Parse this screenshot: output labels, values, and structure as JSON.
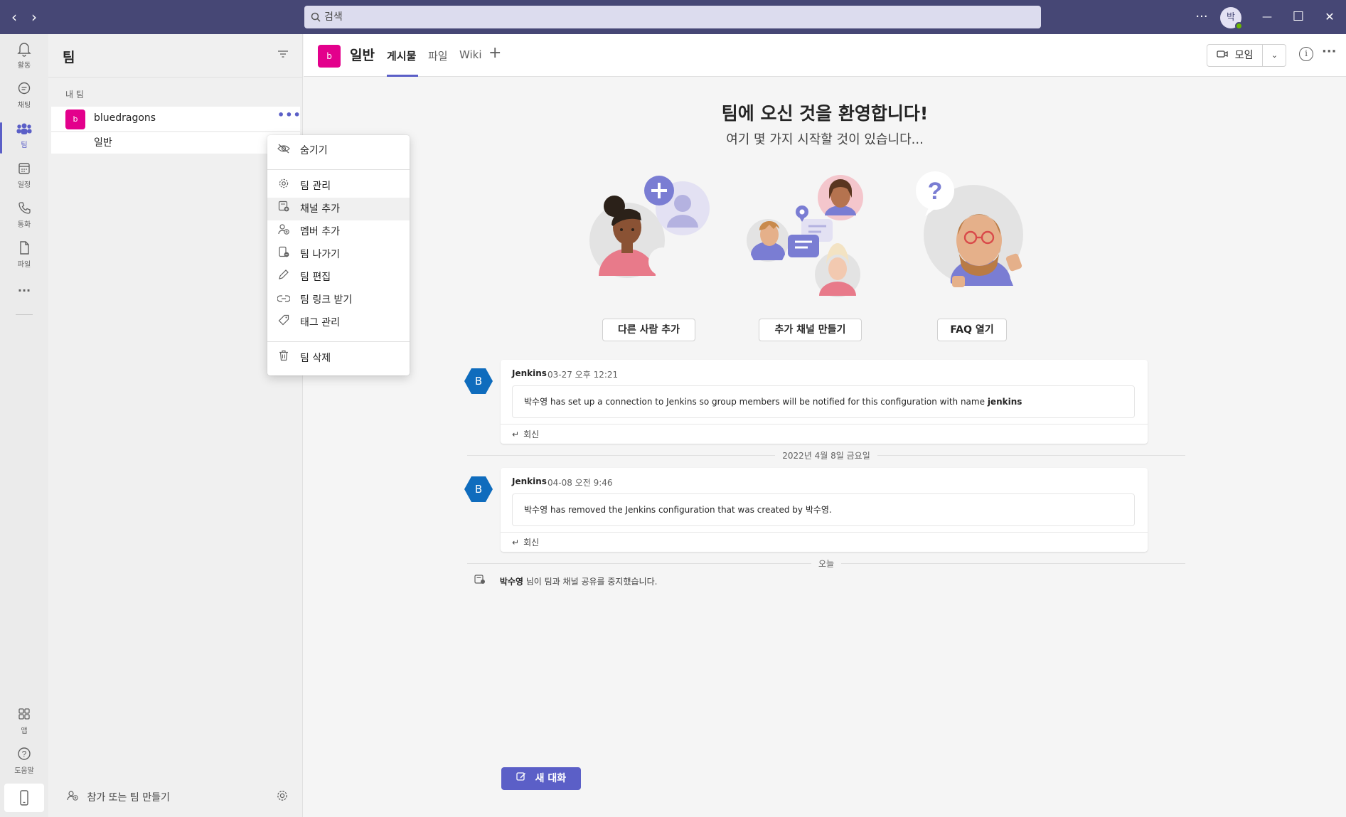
{
  "titlebar": {
    "back_icon": "‹",
    "forward_icon": "›",
    "search_placeholder": "검색",
    "more": "···",
    "avatar_initial": "박",
    "minimize": "—",
    "maximize": "☐",
    "close": "✕"
  },
  "rail": {
    "items": [
      {
        "label": "활동",
        "icon": "bell-icon"
      },
      {
        "label": "채팅",
        "icon": "chat-icon"
      },
      {
        "label": "팀",
        "icon": "teams-icon"
      },
      {
        "label": "일정",
        "icon": "calendar-icon"
      },
      {
        "label": "통화",
        "icon": "phone-icon"
      },
      {
        "label": "파일",
        "icon": "file-icon"
      }
    ],
    "more": "···",
    "apps_label": "앱",
    "help_label": "도움말"
  },
  "panel": {
    "title": "팀",
    "section_label": "내 팀",
    "team": {
      "avatar": "b",
      "name": "bluedragons",
      "more": "•••"
    },
    "channel": {
      "name": "일반"
    },
    "join_label": "참가 또는 팀 만들기"
  },
  "context_menu": {
    "items": [
      {
        "label": "숨기기",
        "icon": "hide-icon"
      },
      {
        "label": "팀 관리",
        "icon": "gear-icon"
      },
      {
        "label": "채널 추가",
        "icon": "add-channel-icon"
      },
      {
        "label": "멤버 추가",
        "icon": "add-member-icon"
      },
      {
        "label": "팀 나가기",
        "icon": "leave-team-icon"
      },
      {
        "label": "팀 편집",
        "icon": "pencil-icon"
      },
      {
        "label": "팀 링크 받기",
        "icon": "link-icon"
      },
      {
        "label": "태그 관리",
        "icon": "tag-icon"
      },
      {
        "label": "팀 삭제",
        "icon": "trash-icon"
      }
    ]
  },
  "header": {
    "channel_avatar": "b",
    "channel_name": "일반",
    "tabs": [
      {
        "label": "게시물",
        "active": true
      },
      {
        "label": "파일",
        "active": false
      },
      {
        "label": "Wiki",
        "active": false
      }
    ],
    "meet_label": "모임"
  },
  "welcome": {
    "title": "팀에 오신 것을 환영합니다!",
    "subtitle": "여기 몇 가지 시작할 것이 있습니다...",
    "cards": [
      {
        "label": "다른 사람 추가"
      },
      {
        "label": "추가 채널 만들기"
      },
      {
        "label": "FAQ 열기"
      }
    ]
  },
  "messages": [
    {
      "avatar": "B",
      "author": "Jenkins",
      "time": "03-27 오후 12:21",
      "user": "박수영",
      "text": " has set up a connection to Jenkins so group members will be notified for this configuration with name ",
      "bold_tail": "jenkins",
      "reply": "회신"
    },
    {
      "avatar": "B",
      "author": "Jenkins",
      "time": "04-08 오전 9:46",
      "user": "박수영",
      "text": " has removed the Jenkins configuration that was created by 박수영.",
      "reply": "회신"
    }
  ],
  "dividers": {
    "date1": "2022년 4월 8일 금요일",
    "today": "오늘"
  },
  "system_message": {
    "user": "박수영",
    "text": " 님이 팀과 채널 공유를 중지했습니다."
  },
  "new_conversation": "새 대화",
  "colors": {
    "titlebar": "#464775",
    "accent": "#5b5fc7",
    "team_avatar": "#e3008c",
    "bot_avatar": "#0f6cbd"
  }
}
